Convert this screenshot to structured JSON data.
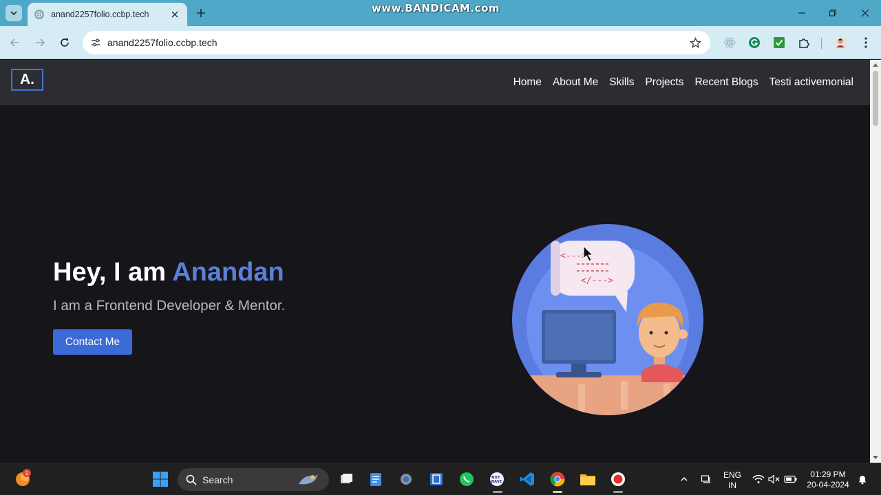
{
  "browser": {
    "tab_title": "anand2257folio.ccbp.tech",
    "url": "anand2257folio.ccbp.tech",
    "watermark": "www.BANDICAM.com"
  },
  "site": {
    "brand": "A.",
    "nav": [
      "Home",
      "About Me",
      "Skills",
      "Projects",
      "Recent Blogs",
      "Testi activemonial"
    ],
    "hero": {
      "greeting": "Hey, I am ",
      "name": "Anandan",
      "subtitle": "I am a Frontend Developer & Mentor.",
      "cta": "Contact Me"
    },
    "colors": {
      "accent": "#5a80d8",
      "button": "#3c6ad6",
      "navbar": "#2b2d33",
      "background": "#16151a"
    }
  },
  "taskbar": {
    "search_label": "Search",
    "notification_count": "1",
    "language_top": "ENG",
    "language_bottom": "IN",
    "time": "01:29 PM",
    "date": "20-04-2024"
  }
}
